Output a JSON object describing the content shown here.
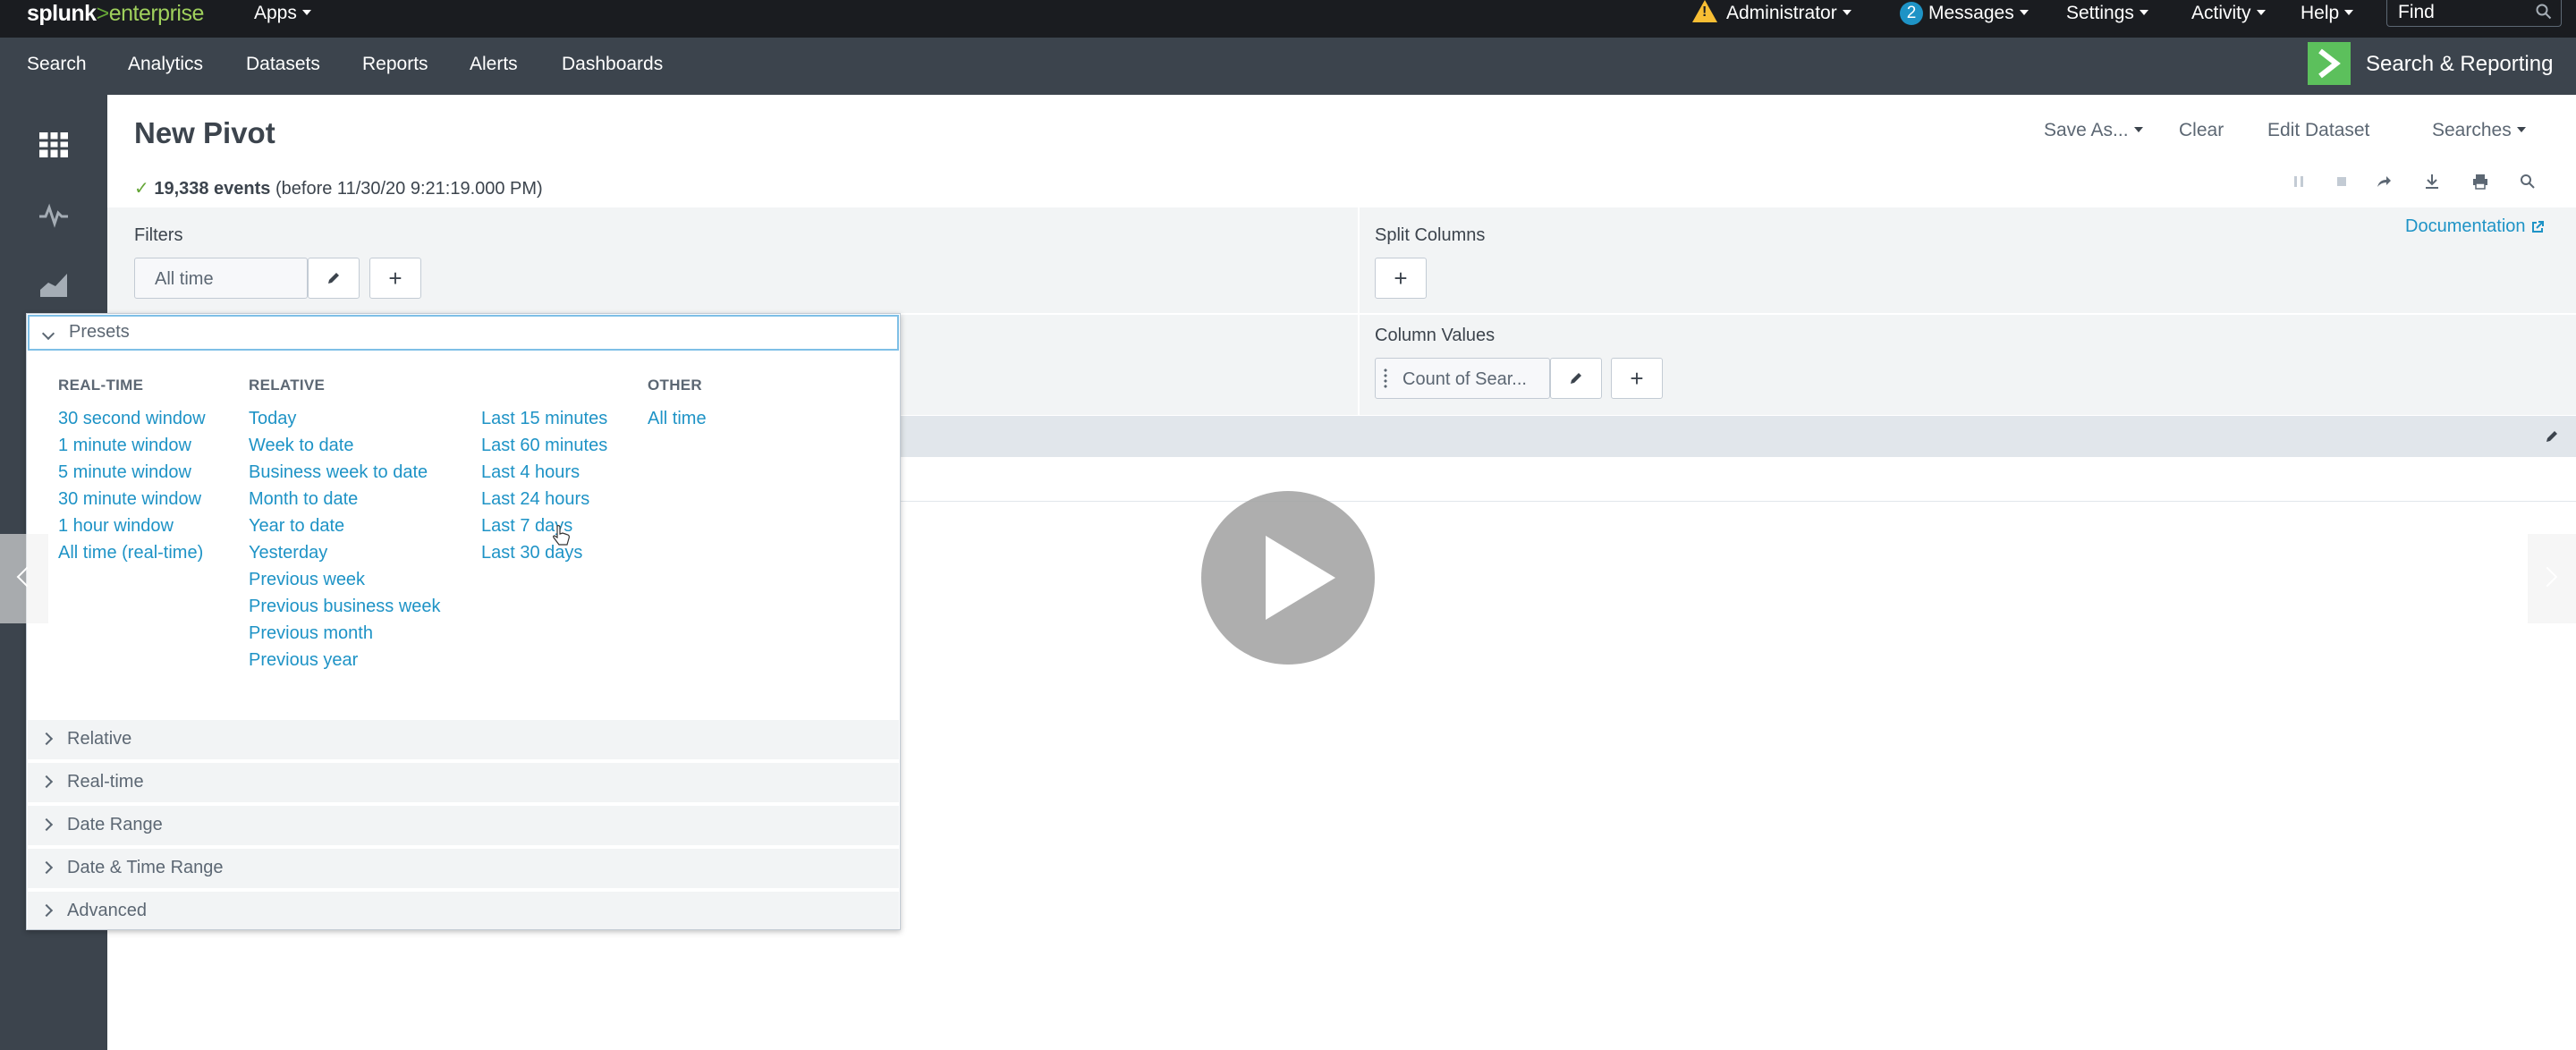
{
  "topbar": {
    "logo_main": "splunk",
    "logo_gt": ">",
    "logo_product": "enterprise",
    "apps_label": "Apps",
    "admin_label": "Administrator",
    "messages_count": "2",
    "messages_label": "Messages",
    "settings_label": "Settings",
    "activity_label": "Activity",
    "help_label": "Help",
    "find_placeholder": "Find"
  },
  "appbar": {
    "nav": [
      "Search",
      "Analytics",
      "Datasets",
      "Reports",
      "Alerts",
      "Dashboards"
    ],
    "app_title": "Search & Reporting"
  },
  "page": {
    "title": "New Pivot",
    "actions": {
      "save_as": "Save As...",
      "clear": "Clear",
      "edit_dataset": "Edit Dataset",
      "searches": "Searches"
    },
    "status": {
      "check": "✓",
      "count": "19,338 events",
      "detail": "(before 11/30/20 9:21:19.000 PM)"
    },
    "documentation": "Documentation"
  },
  "filters": {
    "label": "Filters",
    "value": "All time"
  },
  "split_columns": {
    "label": "Split Columns"
  },
  "column_values": {
    "label": "Column Values",
    "value": "Count of Sear..."
  },
  "timepicker": {
    "presets_label": "Presets",
    "realtime": {
      "header": "REAL-TIME",
      "items": [
        "30 second window",
        "1 minute window",
        "5 minute window",
        "30 minute window",
        "1 hour window",
        "All time (real-time)"
      ]
    },
    "relative": {
      "header": "RELATIVE",
      "items": [
        "Today",
        "Week to date",
        "Business week to date",
        "Month to date",
        "Year to date",
        "Yesterday",
        "Previous week",
        "Previous business week",
        "Previous month",
        "Previous year"
      ]
    },
    "last": {
      "items": [
        "Last 15 minutes",
        "Last 60 minutes",
        "Last 4 hours",
        "Last 24 hours",
        "Last 7 days",
        "Last 30 days"
      ]
    },
    "other": {
      "header": "OTHER",
      "items": [
        "All time"
      ]
    },
    "sections": [
      "Relative",
      "Real-time",
      "Date Range",
      "Date & Time Range",
      "Advanced"
    ]
  },
  "icons": {
    "warning": "warning-icon",
    "search": "search-icon",
    "play": "play-icon",
    "pencil": "pencil-icon"
  },
  "colors": {
    "accent": "#1e93c6",
    "topbar": "#1a1c20",
    "appbar": "#3c444d",
    "brand_green": "#5cc05c",
    "warning": "#f8be34"
  }
}
